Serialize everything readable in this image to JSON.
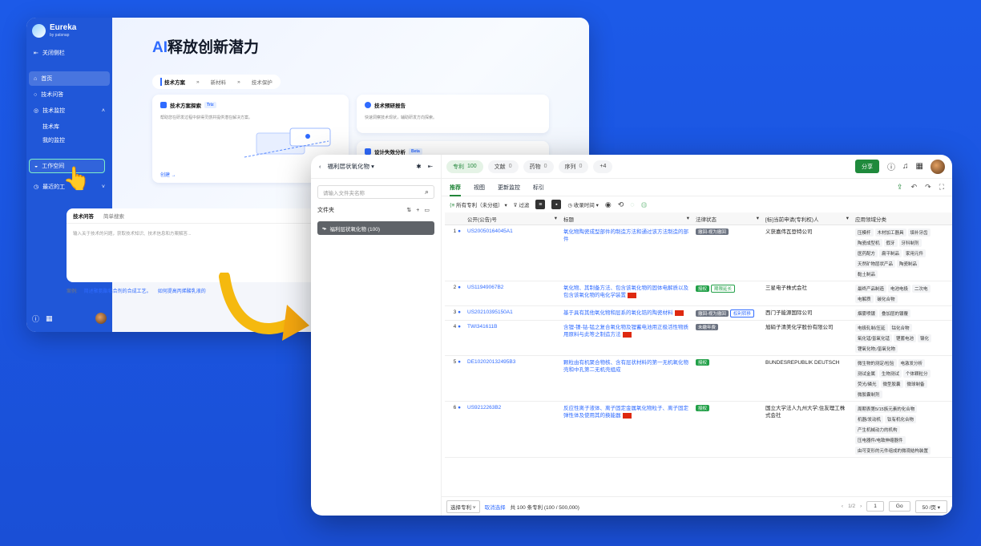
{
  "sidebar": {
    "brand": "Eureka",
    "brand_sub": "by patsnap",
    "collapse": "关闭侧栏",
    "items": [
      {
        "label": "首页"
      },
      {
        "label": "技术问答"
      },
      {
        "label": "技术监控"
      }
    ],
    "sub": [
      "技术库",
      "我的监控"
    ],
    "workspace": "工作空间",
    "recent": "最近的工"
  },
  "hero": {
    "title_ai": "AI",
    "title_rest": "释放创新潜力",
    "crumbs": [
      "技术方案",
      "新材料",
      "技术保护"
    ],
    "card1_title": "技术方案探索",
    "card1_tag": "Triz",
    "card1_desc": "帮助您在研发过程中获得灵感并提供潜在解决方案。",
    "card1_create": "创建 →",
    "card2_title": "技术预研报告",
    "card2_desc": "快速洞察技术现状，辅助研发方向探索。",
    "card3_title": "设计失效分析",
    "card3_tag": "Beta",
    "qa_tabs": [
      "技术问答",
      "简单搜索"
    ],
    "qa_placeholder": "输入关于技术的问题，获取技术知识、技术信息和方案解答...",
    "examples_label": "案例:",
    "example1": "简述聚氨酯粘合剂的合成工艺。",
    "example2": "如何提高丙烯酸乳液的"
  },
  "front": {
    "folder_name": "福利层状氧化物",
    "pills": [
      {
        "label": "专利",
        "count": "100"
      },
      {
        "label": "文献",
        "count": "0"
      },
      {
        "label": "药物",
        "count": "0"
      },
      {
        "label": "序列",
        "count": "0"
      }
    ],
    "plus": "+4",
    "share": "分享",
    "search_placeholder": "请输入文件夹名称",
    "folders_label": "文件夹",
    "folder_item": "福利层状氧化物 (100)",
    "tabs": [
      "推荐",
      "视图",
      "更新监控",
      "标引"
    ],
    "filter_all": "所有专利（未分组）",
    "filter": "过滤",
    "sort": "收录时间",
    "cols": [
      "公开(公告)号",
      "标题",
      "法律状态",
      "[标]当前申请(专利权)人",
      "应用领域分类"
    ],
    "rows": [
      {
        "n": "1",
        "id": "US20050164045A1",
        "title": "氧化物陶瓷成型部件的制造方法和通过该方法制造的部件",
        "flag": false,
        "status": [
          "撤回-视为撤回"
        ],
        "st": [
          "gray"
        ],
        "owner": "义获嘉伟瓦登特公司",
        "apps": [
          "压模杆",
          "木材加工器具",
          "填补牙齿",
          "陶瓷成型机",
          "假牙",
          "牙科制剂",
          "医药配方",
          "扁平制品",
          "家用元件",
          "天然矿物层状产品",
          "陶瓷制品",
          "黏土制品"
        ]
      },
      {
        "n": "2",
        "id": "US11949067B2",
        "title": "氧化物、其制备方法、包含该氧化物的固体电解质以及包含该氧化物的电化学装置",
        "flag": true,
        "status": [
          "授权",
          "期限延长"
        ],
        "st": [
          "green",
          "greenline"
        ],
        "owner": "三星电子株式会社",
        "apps": [
          "最终产品制造",
          "电池电极",
          "二次电",
          "电解质",
          "碳化合物"
        ]
      },
      {
        "n": "3",
        "id": "US20210395150A1",
        "title": "基于具有其他氧化物和层系的氧化锆的陶瓷材料",
        "flag": true,
        "status": [
          "撤回-视为撤回",
          "权利转移"
        ],
        "st": [
          "gray",
          "blueline"
        ],
        "owner": "西门子能源国际公司",
        "apps": [
          "烟雾喷镀",
          "叠加层的镀覆"
        ]
      },
      {
        "n": "4",
        "id": "TWI341611B",
        "title": "含锂-镍-钴-锰之复合氧化物及锂蓄电池用正极活性物质用原料与此等之制造方法",
        "flag": true,
        "status": [
          "未缴年费"
        ],
        "st": [
          "gray"
        ],
        "owner": "旭硝子清美化学股份有限公司",
        "apps": [
          "电极轧制/压延",
          "钴化合物",
          "氧化锰/氢氧化锰",
          "锂蓄电池",
          "镍化",
          "锂氧化物;/氢氧化物"
        ]
      },
      {
        "n": "5",
        "id": "DE102020132495B3",
        "title": "颗粒由有机聚合物核、含有层状材料的第一无机氧化物壳和中孔第二无机壳组成",
        "flag": false,
        "status": [
          "授权"
        ],
        "st": [
          "green"
        ],
        "owner": "BUNDESREPUBLIK DEUTSCH",
        "apps": [
          "微生物的测定/检验",
          "电激发分析",
          "测试金属",
          "生物测试",
          "个体颗粒分",
          "荧光/磷光",
          "微型胶囊",
          "微球制备",
          "微胶囊制剂"
        ]
      },
      {
        "n": "6",
        "id": "US9212263B2",
        "title": "反应性离子液体、离子固定金属氧化物粒子、离子固定弹性体及使用其的换能器",
        "flag": true,
        "status": [
          "授权"
        ],
        "st": [
          "green"
        ],
        "owner": "国立大学法人九州大学;住友理工株式会社",
        "apps": [
          "周期表第5/15族元素的化合物",
          "机器/发动机",
          "钛有机化合物",
          "产生机械动力的机构",
          "压电器件/电致伸缩器件",
          "由可变形的元件组成的微观结构装置"
        ]
      }
    ],
    "foot_select": "选择专利",
    "foot_cancel": "取消选择",
    "foot_total": "共 100 条专利 (100 / 500,000)",
    "page": "1/2",
    "goto": "1",
    "go": "Go",
    "per": "50 /页"
  }
}
